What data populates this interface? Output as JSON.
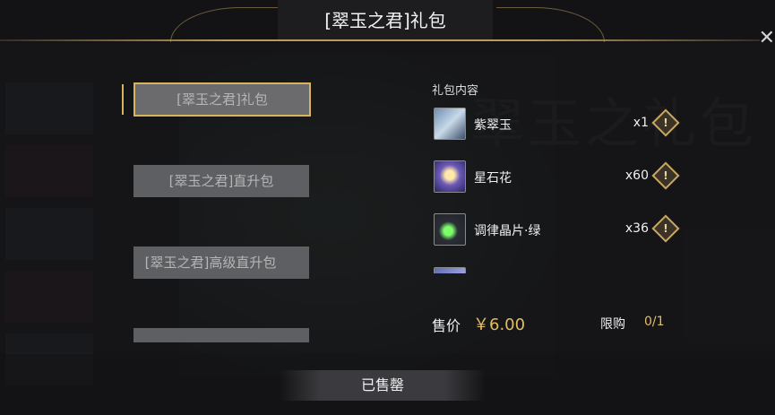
{
  "title": "[翠玉之君]礼包",
  "close_icon": "close-icon",
  "packages": [
    {
      "label": "[翠玉之君]礼包",
      "selected": true
    },
    {
      "label": "[翠玉之君]直升包",
      "selected": false
    },
    {
      "label": "[翠玉之君]高级直升包",
      "selected": false
    },
    {
      "label": "",
      "selected": false
    }
  ],
  "contents": {
    "heading": "礼包内容",
    "items": [
      {
        "name": "紫翠玉",
        "qty": "x1",
        "icon": "character-portrait-icon"
      },
      {
        "name": "星石花",
        "qty": "x60",
        "icon": "star-flower-icon"
      },
      {
        "name": "调律晶片·绿",
        "qty": "x36",
        "icon": "green-crystal-icon"
      },
      {
        "name": "",
        "qty": "",
        "icon": "item-icon"
      }
    ],
    "info_glyph": "!"
  },
  "price": {
    "label": "售价",
    "value": "￥6.00"
  },
  "limit": {
    "label": "限购",
    "value": "0/1"
  },
  "status_button": "已售罄",
  "colors": {
    "accent_gold": "#d9b45f",
    "price_gold": "#e2bd62"
  }
}
